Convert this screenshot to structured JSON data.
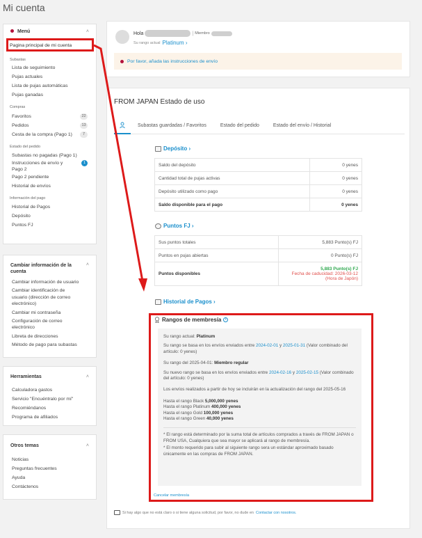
{
  "page_title": "Mi cuenta",
  "sidebar": {
    "menu_title": "Menú",
    "home_link": "Pagina principal de mi cuenta",
    "groups": [
      {
        "title": "Subastas",
        "items": [
          {
            "label": "Lista de seguimiento"
          },
          {
            "label": "Pujas actuales"
          },
          {
            "label": "Lista de pujas automáticas"
          },
          {
            "label": "Pujas ganadas"
          }
        ]
      },
      {
        "title": "Compras",
        "items": [
          {
            "label": "Favoritos",
            "count": "22"
          },
          {
            "label": "Pedidos",
            "count": "13"
          },
          {
            "label": "Cesta de la compra (Pago 1)",
            "count": "7"
          }
        ]
      },
      {
        "title": "Estado del pedido",
        "items": [
          {
            "label": "Subastas no pagadas (Pago 1)"
          },
          {
            "label": "Instrucciones de envío y Pago 2",
            "count": "1"
          },
          {
            "label": "Pago 2 pendiente"
          },
          {
            "label": "Historial de envíos"
          }
        ]
      },
      {
        "title": "Información del pago",
        "items": [
          {
            "label": "Historial de Pagos"
          },
          {
            "label": "Depósito"
          },
          {
            "label": "Puntos FJ"
          }
        ]
      }
    ],
    "cambiar": {
      "title": "Cambiar información de la cuenta",
      "items": [
        "Cambiar información de usuario",
        "Cambiar identificación de usuario (dirección de correo electrónico)",
        "Cambiar mi contraseña",
        "Configuración de correo electrónico",
        "Libreta de direcciones",
        "Método de pago para subastas"
      ]
    },
    "herramientas": {
      "title": "Herramientas",
      "items": [
        "Calculadora gastos",
        "Servicio \"Encuéntralo por mí\"",
        "Recomiéndanos",
        "Programa de afiliados"
      ]
    },
    "otros": {
      "title": "Otros temas",
      "items": [
        "Noticias",
        "Preguntas frecuentes",
        "Ayuda",
        "Contáctenos"
      ]
    }
  },
  "header_card": {
    "hola": "Hola",
    "miembro": "Miembro",
    "rank_label": "Su rango actual",
    "rank_value": "Platinum ›",
    "notice": "Por favor, añada las instrucciones de envío"
  },
  "status": {
    "title": "FROM JAPAN Estado de uso",
    "tabs": [
      "Subastas guardadas / Favoritos",
      "Estado del pedido",
      "Estado del envío / Historial"
    ],
    "deposito": {
      "title": "Depósito ›",
      "rows": [
        {
          "label": "Saldo del depósito",
          "value": "0 yenes"
        },
        {
          "label": "Cantidad total de pujas activas",
          "value": "0 yenes"
        },
        {
          "label": "Depósito utilizado como pago",
          "value": "0 yenes"
        },
        {
          "label": "Saldo disponible para el pago",
          "value": "0 yenes"
        }
      ]
    },
    "puntos": {
      "title": "Puntos FJ ›",
      "rows": [
        {
          "label": "Sus puntos totales",
          "value": "5,883 Punto(s) FJ"
        },
        {
          "label": "Puntos en pujas abiertas",
          "value": "0 Punto(s) FJ"
        },
        {
          "label": "Puntos disponibles",
          "value": "5,883 Punto(s) FJ",
          "expiry": "Fecha de caducidad: 2026-03-12",
          "tz": "(Hora de Japón)"
        }
      ]
    },
    "historial": "Historial de Pagos ›",
    "rangos": {
      "title": "Rangos de membresía",
      "current_label": "Su rango actual:",
      "current_value": "Platinum",
      "p1_pre": "Su rango se basa en los envíos enviados entre",
      "p1_d1": "2024-02-01",
      "p1_y": "y",
      "p1_d2": "2025-01-31",
      "p1_post": "(Valor combinado del artículo: 0 yenes)",
      "next_label": "Su rango del 2025-04-01:",
      "next_value": "Miembro regular",
      "p2_pre": "Su nuevo rango se basa en los envíos enviados entre",
      "p2_d1": "2024-02-16",
      "p2_y": "y",
      "p2_d2": "2025-02-15",
      "p2_post": "(Valor combinado del artículo: 0 yenes)",
      "p3": "Los envíos realizados a partir de hoy se incluirán en la actualización del rango del 2025-05-16",
      "thresholds": [
        {
          "label": "Hasta el rango Black",
          "value": "5,000,000 yenes"
        },
        {
          "label": "Hasta el rango Platinum",
          "value": "400,000 yenes"
        },
        {
          "label": "Hasta el rango Gold",
          "value": "100,000 yenes"
        },
        {
          "label": "Hasta el rango Green",
          "value": "40,000 yenes"
        }
      ],
      "note1": "* El rango está determinado por la suma total de artículos comprados a través de FROM JAPAN o FROM USA, Cualquiera que sea mayor se aplicará al rango de membresía.",
      "note2": "* El monto requerido para subir al siguiente rango sera un estándar aproximado basado únicamente en las compras de FROM JAPAN.",
      "cancel": "Cancelar membresía"
    },
    "footer_pre": "Si hay algo que no está claro o si tiene alguna solicitud, por favor, no dude en",
    "footer_link": "Contactar con nosotros."
  },
  "colors": {
    "accent": "#1a8fcc",
    "highlight": "#dd1a1a",
    "brand": "#b3123b"
  }
}
